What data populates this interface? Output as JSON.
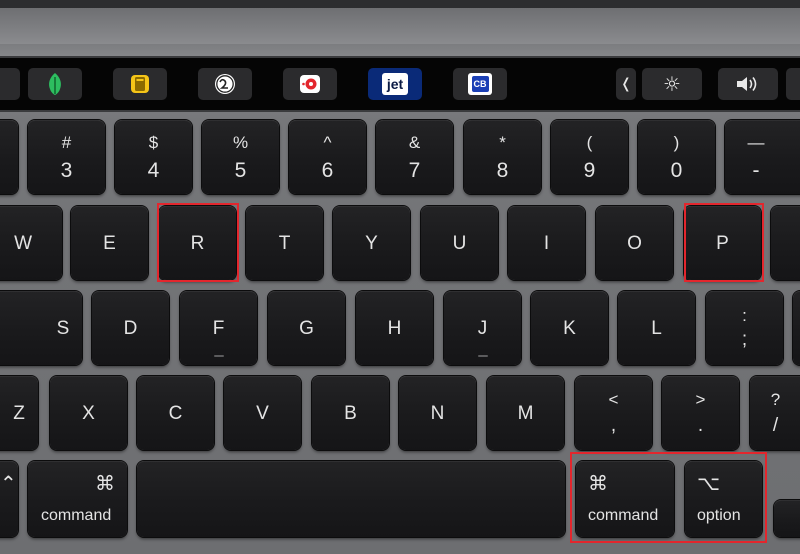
{
  "keyboard": {
    "touch_bar": {
      "app_buttons": [
        {
          "name": "evernote-app-icon",
          "color": "#2dbe60"
        },
        {
          "name": "notes-app-icon",
          "color": "#f5c518"
        },
        {
          "name": "twenty-app-icon",
          "color": "#ffffff"
        },
        {
          "name": "record-app-icon",
          "color": "#e3262d"
        },
        {
          "name": "jet-app-icon",
          "label": "jet",
          "color": "#0a2a78"
        },
        {
          "name": "cb-app-icon",
          "label": "CB",
          "color": "#1b3fb5"
        }
      ],
      "controls": [
        {
          "name": "collapse-chevron-icon",
          "glyph": "❬"
        },
        {
          "name": "brightness-icon",
          "glyph": "☼"
        },
        {
          "name": "volume-icon",
          "glyph": "🔊"
        }
      ]
    },
    "number_row": [
      {
        "top": "",
        "bottom": ""
      },
      {
        "top": "#",
        "bottom": "3"
      },
      {
        "top": "$",
        "bottom": "4"
      },
      {
        "top": "%",
        "bottom": "5"
      },
      {
        "top": "^",
        "bottom": "6"
      },
      {
        "top": "&",
        "bottom": "7"
      },
      {
        "top": "*",
        "bottom": "8"
      },
      {
        "top": "(",
        "bottom": "9"
      },
      {
        "top": ")",
        "bottom": "0"
      },
      {
        "top": "—",
        "bottom": "-"
      }
    ],
    "qwerty_row": [
      "W",
      "E",
      "R",
      "T",
      "Y",
      "U",
      "I",
      "O",
      "P"
    ],
    "home_row": [
      "S",
      "D",
      "F",
      "G",
      "H",
      "J",
      "K",
      "L"
    ],
    "home_row_punct": {
      "top": ":",
      "bottom": ";"
    },
    "bottom_row": [
      "Z",
      "X",
      "C",
      "V",
      "B",
      "N",
      "M"
    ],
    "bottom_row_punct": [
      {
        "top": "<",
        "bottom": ","
      },
      {
        "top": ">",
        "bottom": "."
      },
      {
        "top": "?",
        "bottom": "/"
      }
    ],
    "modifiers": {
      "left_partial_glyph": "⌃",
      "left_command": {
        "glyph": "⌘",
        "word": "command"
      },
      "right_command": {
        "glyph": "⌘",
        "word": "command"
      },
      "right_option": {
        "glyph": "⌥",
        "word": "option"
      }
    },
    "highlight_color": "#e3262d"
  }
}
